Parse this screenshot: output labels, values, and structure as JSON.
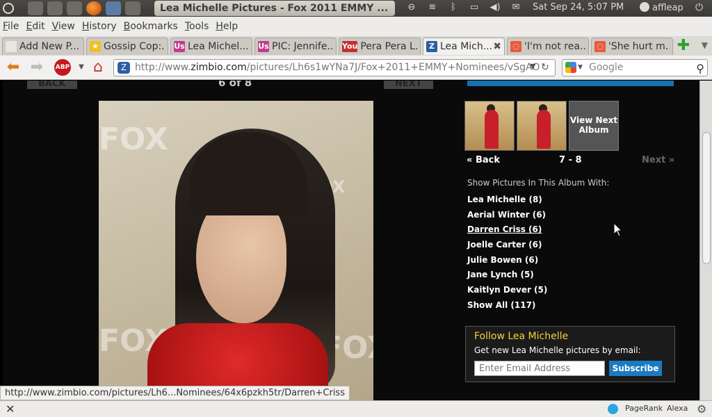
{
  "panel": {
    "window_title": "Lea Michelle Pictures - Fox 2011 EMMY ...",
    "clock": "Sat Sep 24,  5:07 PM",
    "user": "affleap"
  },
  "menu": [
    "File",
    "Edit",
    "View",
    "History",
    "Bookmarks",
    "Tools",
    "Help"
  ],
  "tabs": [
    {
      "title": "Add New P...",
      "icon": "page-icon",
      "fav_color": "#e8e6e1",
      "fav_text": ""
    },
    {
      "title": "Gossip Cop:...",
      "icon": "star-icon",
      "fav_color": "#f0c020",
      "fav_text": "★"
    },
    {
      "title": "Lea Michel...",
      "icon": "usmagazine-icon",
      "fav_color": "#c43a8f",
      "fav_text": "Us"
    },
    {
      "title": "PIC: Jennife...",
      "icon": "usmagazine-icon",
      "fav_color": "#c43a8f",
      "fav_text": "Us"
    },
    {
      "title": "Pera Pera L...",
      "icon": "youtube-icon",
      "fav_color": "#c4302b",
      "fav_text": "You"
    },
    {
      "title": "Lea Mich...",
      "icon": "zimbio-icon",
      "fav_color": "#2d5ea5",
      "fav_text": "Z",
      "active": true
    },
    {
      "title": "'I'm not rea...",
      "icon": "spinner-icon",
      "fav_color": "#e85a3c",
      "fav_text": "◌"
    },
    {
      "title": "'She hurt m...",
      "icon": "spinner-icon",
      "fav_color": "#e85a3c",
      "fav_text": "◌"
    }
  ],
  "navbar": {
    "url_prefix": "http://www.",
    "url_host": "zimbio.com",
    "url_rest": "/pictures/Lh6s1wYNa7J/Fox+2011+EMMY+Nominees/vSgAO",
    "search_placeholder": "Google",
    "abp_label": "ABP"
  },
  "page": {
    "back_top": "BACK",
    "next_top": "NEXT",
    "pager": "6 of 8",
    "thumb_back": "Back",
    "thumb_range": "7 - 8",
    "thumb_next": "Next",
    "view_next_album": "View Next Album",
    "album_label": "Show Pictures In This Album With:",
    "tags": [
      {
        "label": "Lea Michelle (8)"
      },
      {
        "label": "Aerial Winter (6)"
      },
      {
        "label": "Darren Criss (6)",
        "hover": true
      },
      {
        "label": "Joelle Carter (6)"
      },
      {
        "label": "Julie Bowen (6)"
      },
      {
        "label": "Jane Lynch (5)"
      },
      {
        "label": "Kaitlyn Dever (5)"
      },
      {
        "label": "Show All (117)"
      }
    ],
    "follow_title": "Follow Lea Michelle",
    "follow_sub": "Get new Lea Michelle pictures by email:",
    "email_placeholder": "Enter Email Address",
    "subscribe": "Subscribe"
  },
  "status": {
    "link_url": "http://www.zimbio.com/pictures/Lh6...Nominees/64x6pzkh5tr/Darren+Criss",
    "pagerank": "PageRank",
    "alexa": "Alexa"
  }
}
